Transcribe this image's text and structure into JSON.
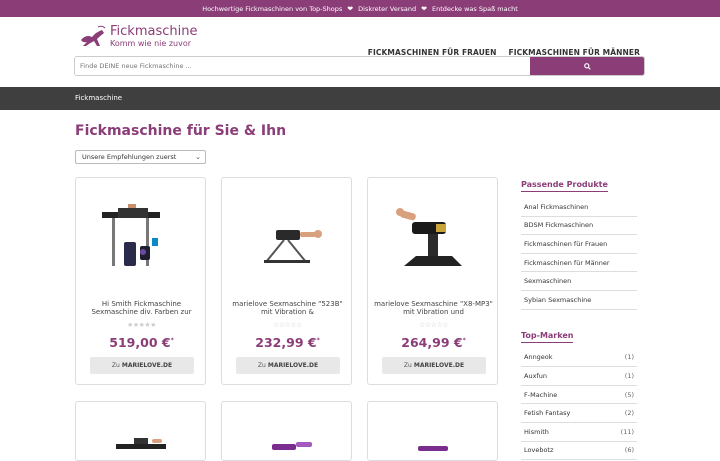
{
  "topbar": {
    "items": [
      "Hochwertige Fickmaschinen von Top-Shops",
      "Diskreter Versand",
      "Entdecke was Spaß macht"
    ]
  },
  "header": {
    "logo_title": "Fickmaschine",
    "logo_sub": "Komm wie nie zuvor",
    "nav": [
      "FICKMASCHINEN FÜR FRAUEN",
      "FICKMASCHINEN FÜR MÄNNER"
    ],
    "search_placeholder": "Finde DEINE neue Fickmaschine ..."
  },
  "breadcrumb": "Fickmaschine",
  "page_title": "Fickmaschine für Sie & Ihn",
  "sort_value": "Unsere Empfehlungen zuerst",
  "products": [
    {
      "name": "Hi Smith Fickmaschine Sexmaschine div. Farben zur",
      "price": "519,00 €",
      "cta_prefix": "Zu",
      "shop": "MARIELOVE.DE",
      "stars": "★★★★★"
    },
    {
      "name": "marielove Sexmaschine \"523B\" mit Vibration &",
      "price": "232,99 €",
      "cta_prefix": "Zu",
      "shop": "MARIELOVE.DE",
      "stars": "☆☆☆☆☆"
    },
    {
      "name": "marielove Sexmaschine \"X8-MP3\" mit Vibration und",
      "price": "264,99 €",
      "cta_prefix": "Zu",
      "shop": "MARIELOVE.DE",
      "stars": "☆☆☆☆☆"
    }
  ],
  "sidebar": {
    "section1_title": "Passende Produkte",
    "section1_items": [
      "Anal Fickmaschinen",
      "BDSM Fickmaschinen",
      "Fickmaschinen für Frauen",
      "Fickmaschinen für Männer",
      "Sexmaschinen",
      "Sybian Sexmaschine"
    ],
    "section2_title": "Top-Marken",
    "section2_items": [
      {
        "label": "Anngeok",
        "count": "(1)"
      },
      {
        "label": "Auxfun",
        "count": "(1)"
      },
      {
        "label": "F-Machine",
        "count": "(5)"
      },
      {
        "label": "Fetish Fantasy",
        "count": "(2)"
      },
      {
        "label": "Hismith",
        "count": "(11)"
      },
      {
        "label": "Lovebotz",
        "count": "(6)"
      }
    ]
  },
  "colors": {
    "brand": "#8b3d78",
    "breadcrumb_bg": "#3f3f3f"
  }
}
